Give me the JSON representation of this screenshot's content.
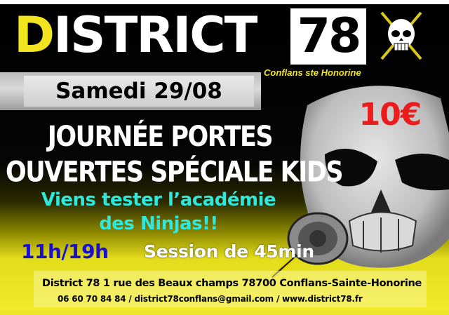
{
  "header": {
    "title_first_letter": "D",
    "title_rest": "ISTRICT",
    "title_number": "78",
    "city": "Conflans ste Honorine",
    "logo_icon": "skull-crossed-swords-icon"
  },
  "event": {
    "date": "Samedi 29/08",
    "price": "10€",
    "headline_line1": "JOURNÉE PORTES",
    "headline_line2": "OUVERTES SPÉCIALE KIDS",
    "tagline_line1": "Viens tester l’académie",
    "tagline_line2": "des Ninjas!!",
    "hours": "11h/19h",
    "session": "Session de 45min"
  },
  "footer": {
    "address": "District 78  1 rue des Beaux champs 78700 Conflans-Sainte-Honorine",
    "contact": "06 60 70 84 84 / district78conflans@gmail.com / www.district78.fr"
  },
  "colors": {
    "brand_yellow": "#f2e51f",
    "price_red": "#ea1c1c",
    "tagline_cyan": "#2ee8de",
    "hours_blue": "#1a10c8"
  }
}
